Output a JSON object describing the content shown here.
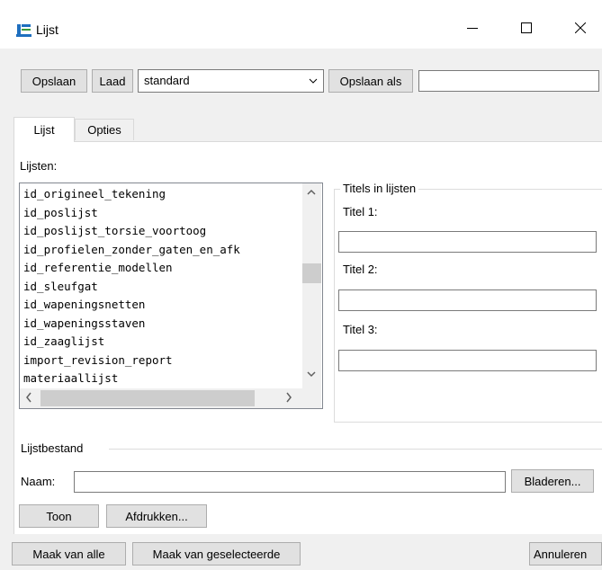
{
  "window": {
    "title": "Lijst"
  },
  "toolbar": {
    "save_label": "Opslaan",
    "load_label": "Laad",
    "preset_value": "standard",
    "save_as_label": "Opslaan als",
    "save_as_value": ""
  },
  "tabs": [
    {
      "label": "Lijst",
      "active": true
    },
    {
      "label": "Opties",
      "active": false
    }
  ],
  "lists": {
    "label": "Lijsten:",
    "items": [
      "id_origineel_tekening",
      "id_poslijst",
      "id_poslijst_torsie_voortoog",
      "id_profielen_zonder_gaten_en_afk",
      "id_referentie_modellen",
      "id_sleufgat",
      "id_wapeningsnetten",
      "id_wapeningsstaven",
      "id_zaaglijst",
      "import_revision_report",
      "materiaallijst"
    ]
  },
  "titles": {
    "group_label": "Titels in lijsten",
    "title1_label": "Titel 1:",
    "title1_value": "",
    "title2_label": "Titel 2:",
    "title2_value": "",
    "title3_label": "Titel 3:",
    "title3_value": ""
  },
  "file": {
    "section_label": "Lijstbestand",
    "name_label": "Naam:",
    "name_value": "",
    "browse_label": "Bladeren...",
    "show_label": "Toon",
    "print_label": "Afdrukken..."
  },
  "footer": {
    "make_all_label": "Maak van alle",
    "make_selected_label": "Maak van geselecteerde",
    "cancel_label": "Annuleren"
  },
  "colors": {
    "window_bg": "#f0f0f0",
    "panel_bg": "#ffffff",
    "button_bg": "#e1e1e1",
    "icon_accent": "#1f6fbf"
  }
}
